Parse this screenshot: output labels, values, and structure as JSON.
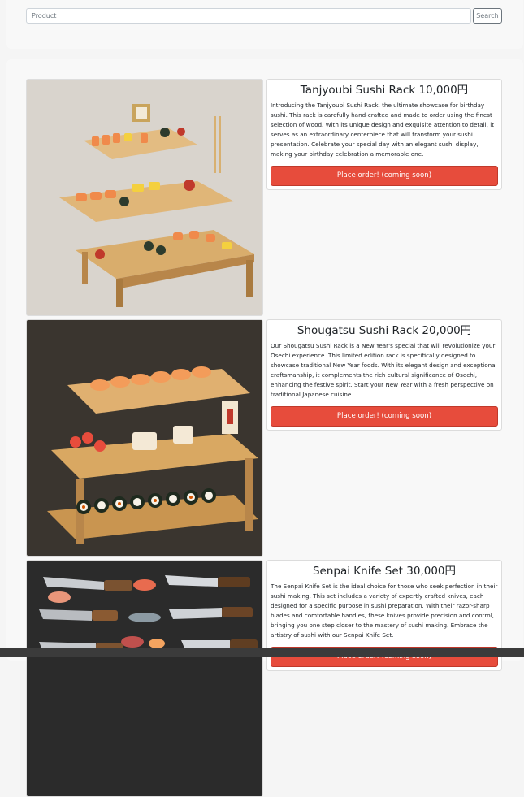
{
  "search": {
    "placeholder": "Product",
    "button_label": "Search"
  },
  "products": [
    {
      "title": "Tanjyoubi Sushi Rack 10,000円",
      "description": "Introducing the Tanjyoubi Sushi Rack, the ultimate showcase for birthday sushi. This rack is carefully hand-crafted and made to order using the finest selection of wood. With its unique design and exquisite attention to detail, it serves as an extraordinary centerpiece that will transform your sushi presentation. Celebrate your special day with an elegant sushi display, making your birthday celebration a memorable one.",
      "button_label": "Place order! (coming soon)"
    },
    {
      "title": "Shougatsu Sushi Rack 20,000円",
      "description": "Our Shougatsu Sushi Rack is a New Year's special that will revolutionize your Osechi experience. This limited edition rack is specifically designed to showcase traditional New Year foods. With its elegant design and exceptional craftsmanship, it complements the rich cultural significance of Osechi, enhancing the festive spirit. Start your New Year with a fresh perspective on traditional Japanese cuisine.",
      "button_label": "Place order! (coming soon)"
    },
    {
      "title": "Senpai Knife Set 30,000円",
      "description": "The Senpai Knife Set is the ideal choice for those who seek perfection in their sushi making. This set includes a variety of expertly crafted knives, each designed for a specific purpose in sushi preparation. With their razor-sharp blades and comfortable handles, these knives provide precision and control, bringing you one step closer to the mastery of sushi making. Embrace the artistry of sushi with our Senpai Knife Set.",
      "button_label": "Place order! (coming soon)"
    }
  ],
  "colors": {
    "order_button": "#e74c3c",
    "page_background": "#f5f5f5"
  }
}
